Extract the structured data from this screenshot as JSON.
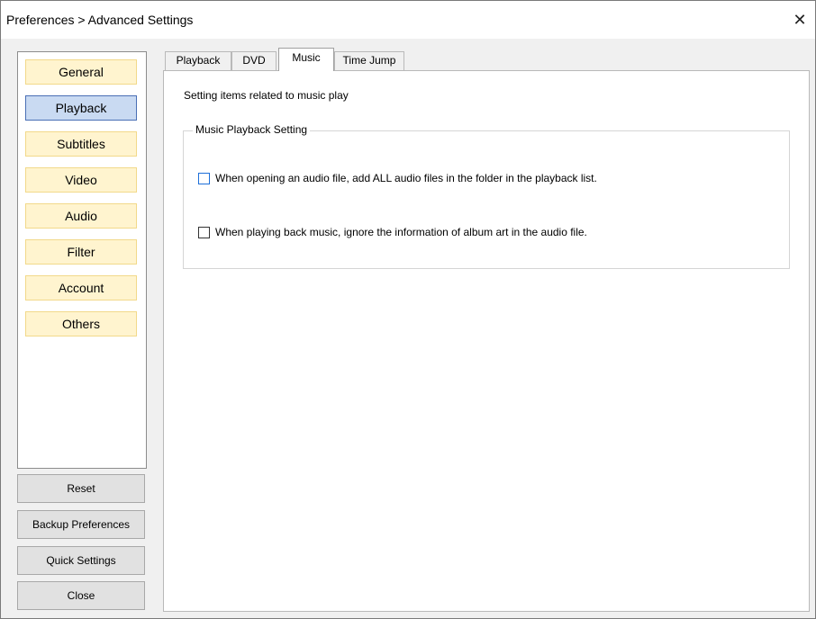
{
  "window": {
    "title": "Preferences > Advanced Settings",
    "close_symbol": "✕"
  },
  "sidebar": {
    "items": [
      {
        "label": "General",
        "selected": false
      },
      {
        "label": "Playback",
        "selected": true
      },
      {
        "label": "Subtitles",
        "selected": false
      },
      {
        "label": "Video",
        "selected": false
      },
      {
        "label": "Audio",
        "selected": false
      },
      {
        "label": "Filter",
        "selected": false
      },
      {
        "label": "Account",
        "selected": false
      },
      {
        "label": "Others",
        "selected": false
      }
    ]
  },
  "buttons": {
    "reset": "Reset",
    "backup": "Backup Preferences",
    "quick": "Quick Settings",
    "close": "Close"
  },
  "tabs": [
    {
      "label": "Playback",
      "active": false
    },
    {
      "label": "DVD",
      "active": false
    },
    {
      "label": "Music",
      "active": true
    },
    {
      "label": "Time Jump",
      "active": false
    }
  ],
  "music": {
    "description": "Setting items related to music play",
    "group_title": "Music Playback Setting",
    "option_add_all": {
      "label": "When opening an audio file, add ALL audio files in the folder in the playback list.",
      "checked": false
    },
    "option_ignore_art": {
      "label": "When playing back music, ignore the information of album art in the audio file.",
      "checked": false
    }
  },
  "colors": {
    "nav_item_bg": "#fff4cf",
    "nav_item_selected_bg": "#c9daf2",
    "focus_accent": "#1e6fd9"
  }
}
